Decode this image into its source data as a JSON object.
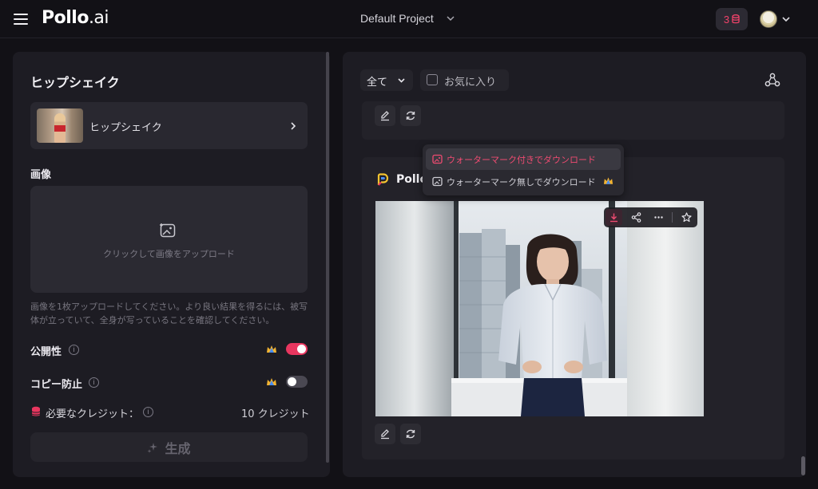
{
  "header": {
    "brand_main": "Pollo",
    "brand_suffix": ".ai",
    "project_name": "Default Project",
    "credits": "3"
  },
  "left": {
    "title": "ヒップシェイク",
    "template_label": "ヒップシェイク",
    "image_label": "画像",
    "upload_text": "クリックして画像をアップロード",
    "hint": "画像を1枚アップロードしてください。より良い結果を得るには、被写体が立っていて、全身が写っていることを確認してください。",
    "public_label": "公開性",
    "public_on": true,
    "copy_protect_label": "コピー防止",
    "copy_protect_on": false,
    "credits_needed_label": "必要なクレジット：",
    "credits_needed_value": "10 クレジット",
    "generate_label": "生成"
  },
  "right": {
    "filter_all": "全て",
    "favorites": "お気に入り",
    "card_brand": "Pollo",
    "download_menu": [
      {
        "label": "ウォーターマーク付きでダウンロード",
        "active": true
      },
      {
        "label": "ウォーターマーク無しでダウンロード",
        "active": false,
        "premium": true
      }
    ]
  },
  "colors": {
    "accent": "#e8365f",
    "panel": "#1d1c23",
    "background": "#121116"
  },
  "icons": [
    "menu-icon",
    "chevron-down-icon",
    "database-icon",
    "chevron-right-icon",
    "image-upload-icon",
    "info-icon",
    "crown-icon",
    "sparkle-icon",
    "share-icon",
    "edit-icon",
    "refresh-icon",
    "download-icon",
    "more-icon",
    "star-icon",
    "image-icon"
  ]
}
